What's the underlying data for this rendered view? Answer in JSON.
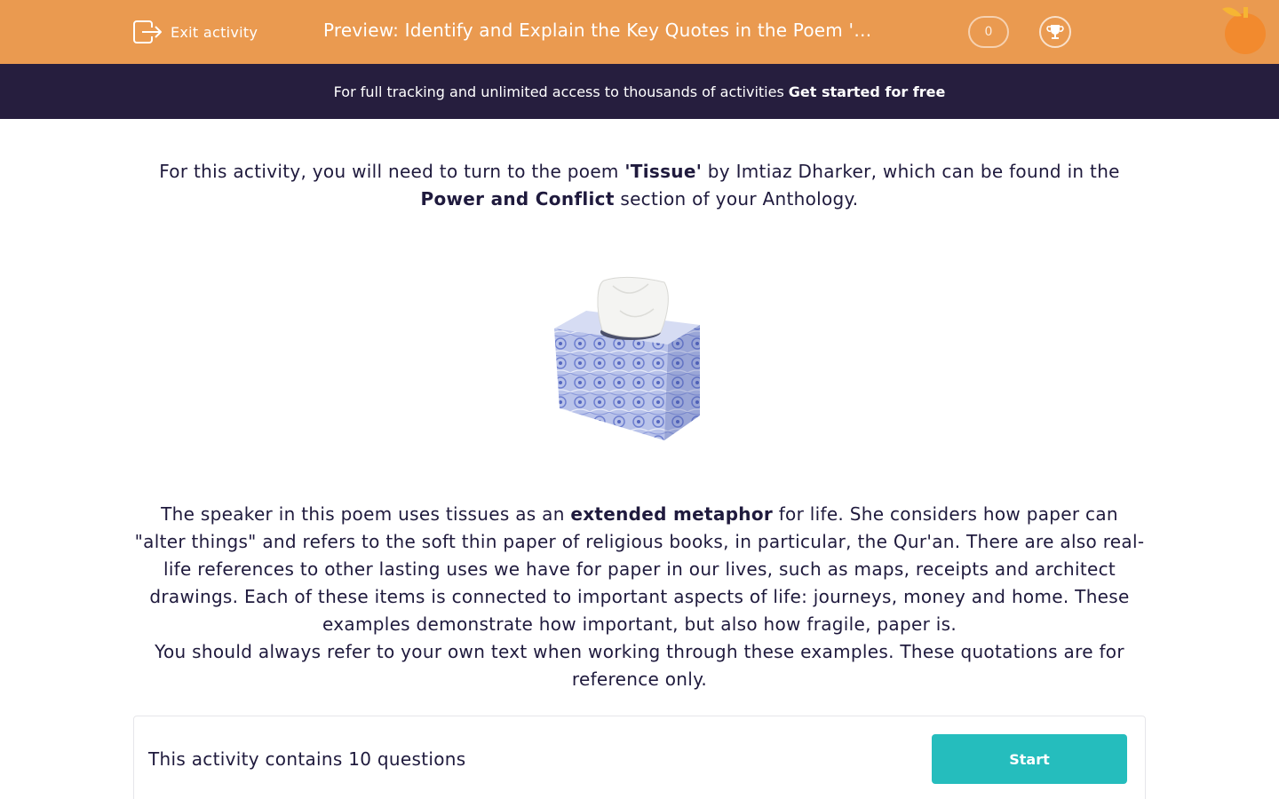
{
  "header": {
    "exit_label": "Exit activity",
    "title": "Preview: Identify and Explain the Key Quotes in the Poem 'Tissue'",
    "score": "0",
    "exit_icon": "exit-door-icon",
    "trophy_icon": "trophy-icon",
    "logo_icon": "orange-logo",
    "bg_color": "#ea9a50"
  },
  "banner": {
    "text": "For full tracking and unlimited access to thousands of activities",
    "cta": "Get started for free",
    "bg_color": "#261e3e"
  },
  "intro": {
    "part1": "For this activity, you will need to turn to the poem ",
    "poem": "'Tissue'",
    "part2": " by Imtiaz Dharker, which can be found in the ",
    "section": "Power and Conflict",
    "part3": " section of your Anthology."
  },
  "image": {
    "subject": "tissue-box"
  },
  "description": {
    "part1": "The speaker in this poem uses tissues as an ",
    "term": "extended metaphor",
    "part2": " for life. She considers how paper can \"alter things\" and refers to the soft thin paper of religious books, in particular, the Qur'an. There are also real-life references to other lasting uses we have for paper in our lives, such as maps, receipts and architect drawings. Each of these items is connected to important aspects of life: journeys, money and home. These examples demonstrate how important, but also how fragile, paper is.",
    "note": "You should always refer to your own text when working through these examples. These quotations are for reference only."
  },
  "activity": {
    "summary": "This activity contains 10 questions",
    "start_label": "Start",
    "button_color": "#25bdbd"
  }
}
